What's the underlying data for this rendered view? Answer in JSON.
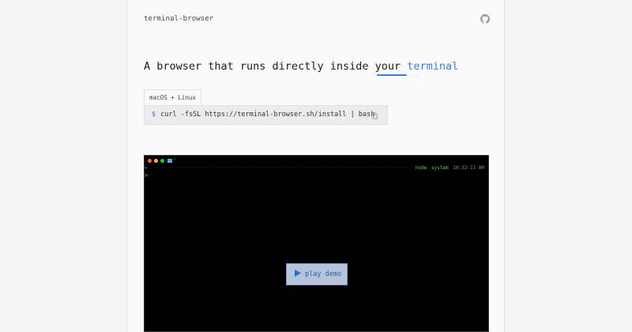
{
  "header": {
    "site_name": "terminal-browser",
    "github_icon": "github-icon"
  },
  "hero": {
    "headline_prefix": "A browser that runs directly inside your ",
    "headline_accent": "terminal",
    "accent_color": "#3b7dd8"
  },
  "install": {
    "tab_label": "macOS + Linux",
    "prompt_symbol": "$",
    "command": "curl -fsSL https://terminal-browser.sh/install | bash",
    "copy_icon": "copy-icon"
  },
  "terminal": {
    "status_arrow": "←",
    "status_node": "node",
    "status_context": "system",
    "status_time": "10:32:11 AM",
    "folder_label": "~",
    "prompt_char": ">",
    "play_label": "play demo"
  }
}
